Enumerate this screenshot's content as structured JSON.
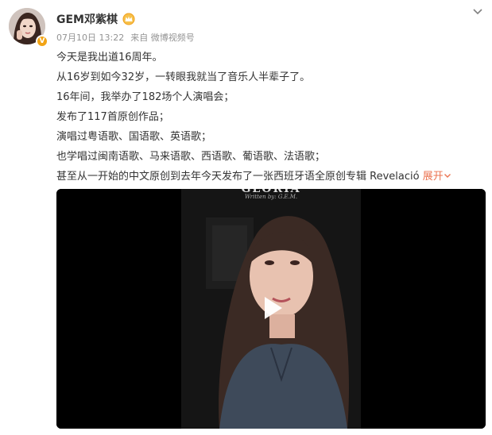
{
  "post": {
    "author": "GEM邓紫棋",
    "date": "07月10日 13:22",
    "source_prefix": "来自",
    "source": "微博视频号",
    "lines": [
      "今天是我出道16周年。",
      "从16岁到如今32岁，一转眼我就当了音乐人半辈子了。",
      "16年间，我举办了182场个人演唱会；",
      "发布了117首原创作品；",
      "演唱过粤语歌、国语歌、英语歌；",
      "也学唱过闽南语歌、马来语歌、西语歌、葡语歌、法语歌；",
      "甚至从一开始的中文原创到去年今天发布了一张西班牙语全原创专辑 Revelació"
    ],
    "expand_label": "展开",
    "video": {
      "overlay_title": "GLORIA",
      "overlay_credit": "Written by: G.E.M."
    }
  },
  "colors": {
    "accent": "#eb7350",
    "meta": "#939393",
    "verified": "#f2a415"
  },
  "icons": [
    "avatar",
    "verified-badge-icon",
    "crown-icon",
    "chevron-down-icon",
    "play-icon"
  ]
}
